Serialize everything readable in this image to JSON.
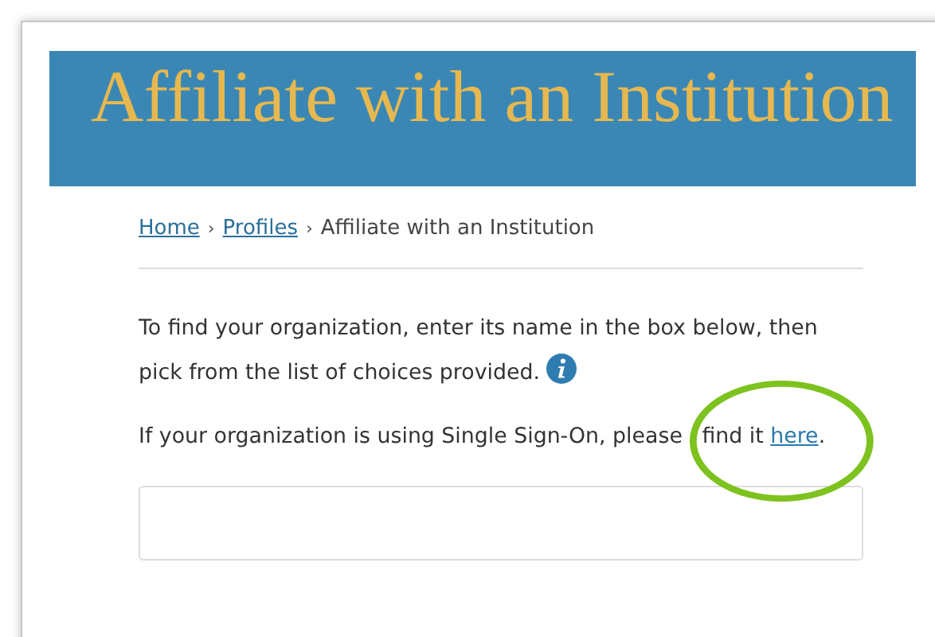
{
  "banner": {
    "title": "Affiliate with an Institution"
  },
  "breadcrumb": [
    {
      "label": "Home",
      "kind": "link"
    },
    {
      "label": "›",
      "kind": "separator"
    },
    {
      "label": "Profiles",
      "kind": "link"
    },
    {
      "label": "›",
      "kind": "separator"
    },
    {
      "label": "Affiliate with an Institution",
      "kind": "current"
    }
  ],
  "intro": {
    "text": "To find your organization, enter its name in the box below, then pick from the list of choices provided."
  },
  "sso": {
    "lead": "If your organization is using Single Sign-On, please",
    "circled": "find it",
    "link": "here",
    "after": "."
  },
  "annotation": {
    "kind": "ellipse",
    "color": "#7dc21e"
  }
}
